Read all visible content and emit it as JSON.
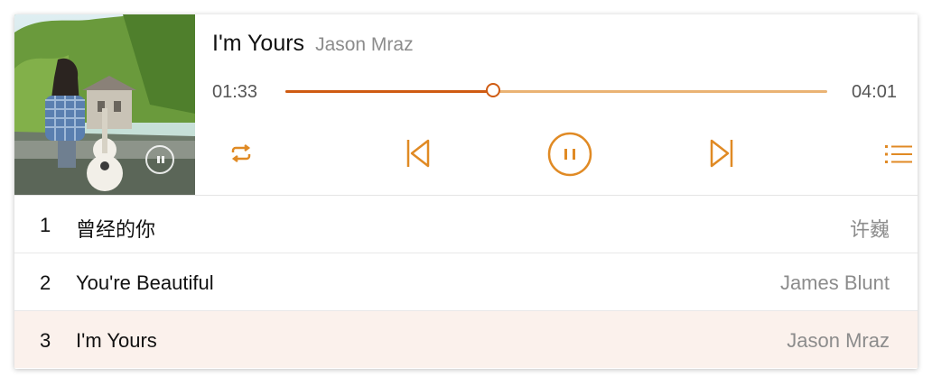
{
  "player": {
    "title": "I'm Yours",
    "artist": "Jason Mraz",
    "current_time": "01:33",
    "total_time": "04:01",
    "progress": 0.385,
    "state": "playing",
    "accent_color": "#e08a24"
  },
  "controls": {
    "repeat": "repeat-icon",
    "previous": "skip-previous-icon",
    "play_pause": "pause-icon",
    "next": "skip-next-icon",
    "playlist": "playlist-icon"
  },
  "playlist": [
    {
      "index": "1",
      "title": "曾经的你",
      "artist": "许巍"
    },
    {
      "index": "2",
      "title": "You're Beautiful",
      "artist": "James Blunt"
    },
    {
      "index": "3",
      "title": "I'm Yours",
      "artist": "Jason Mraz",
      "active": true
    }
  ]
}
